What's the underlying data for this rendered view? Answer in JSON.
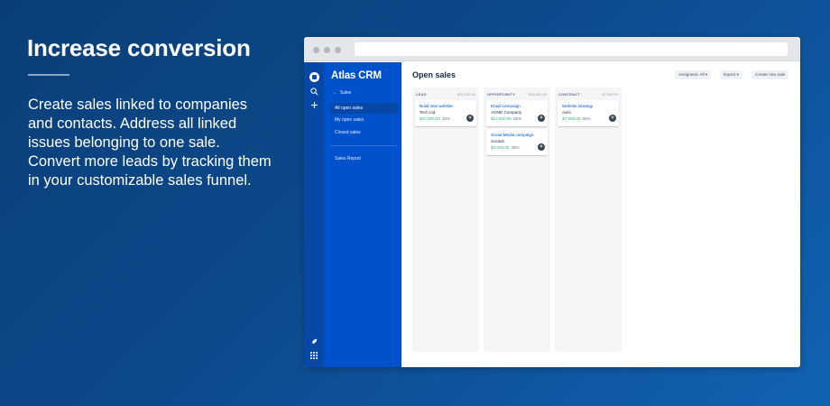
{
  "promo": {
    "title": "Increase conversion",
    "body": "Create sales linked to companies and contacts. Address all linked issues belonging to one sale. Convert more leads by tracking them in your customizable sales funnel."
  },
  "app": {
    "name": "Atlas CRM",
    "rail_icons": [
      "logo-icon",
      "search-icon",
      "plus-icon",
      "rocket-icon",
      "apps-grid-icon"
    ],
    "sidebar": {
      "back_label": "Sales",
      "items": [
        {
          "label": "All open sales",
          "active": true
        },
        {
          "label": "My open sales",
          "active": false
        },
        {
          "label": "Closed sales",
          "active": false
        }
      ],
      "report_label": "Sales Report"
    },
    "page_title": "Open sales",
    "toolbar": {
      "assignees": "Assignees: All",
      "export": "Export",
      "create": "Create new sale"
    },
    "columns": [
      {
        "name": "LEAD",
        "total": "$20,000.00",
        "cards": [
          {
            "title": "Build new website",
            "company": "Tech Ltd.",
            "value": "$20,000.00",
            "percent": "25%"
          }
        ]
      },
      {
        "name": "OPPORTUNITY",
        "total": "$16,500.00",
        "cards": [
          {
            "title": "Email campaign",
            "company": "ACME Company",
            "value": "$12,500.00",
            "percent": "85%"
          },
          {
            "title": "Social Media campaign",
            "company": "Sociatz",
            "value": "$4,000.00",
            "percent": "40%"
          }
        ]
      },
      {
        "name": "CONTRACT",
        "total": "$7,500.00",
        "cards": [
          {
            "title": "Website strategy",
            "company": "Avisi",
            "value": "$7,500.00",
            "percent": "50%"
          }
        ]
      }
    ]
  },
  "colors": {
    "background": "#0c4a8c",
    "sidebar": "#0052cc",
    "rail": "#0747a6",
    "value_green": "#36b37e",
    "link_blue": "#0052cc"
  }
}
